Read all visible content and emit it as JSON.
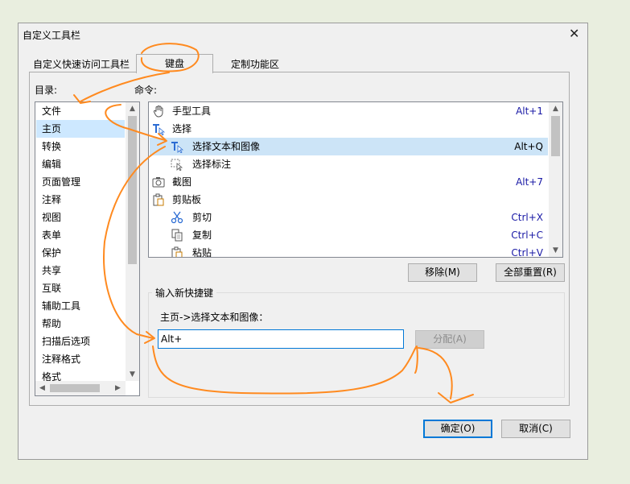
{
  "dialog": {
    "title": "自定义工具栏",
    "close_symbol": "✕"
  },
  "tabs": [
    {
      "label": "自定义快速访问工具栏",
      "active": false
    },
    {
      "label": "键盘",
      "active": true
    },
    {
      "label": "定制功能区",
      "active": false
    }
  ],
  "categories": {
    "label": "目录:",
    "items": [
      "文件",
      "主页",
      "转换",
      "编辑",
      "页面管理",
      "注释",
      "视图",
      "表单",
      "保护",
      "共享",
      "互联",
      "辅助工具",
      "帮助",
      "扫描后选项",
      "注释格式",
      "格式"
    ],
    "selected": "主页"
  },
  "commands": {
    "label": "命令:",
    "items": [
      {
        "label": "手型工具",
        "shortcut": "Alt+1",
        "icon": "hand-icon",
        "indent": false
      },
      {
        "label": "选择",
        "shortcut": "",
        "icon": "select-text-icon",
        "indent": false
      },
      {
        "label": "选择文本和图像",
        "shortcut": "Alt+Q",
        "icon": "select-text-image-icon",
        "indent": true,
        "selected": true
      },
      {
        "label": "选择标注",
        "shortcut": "",
        "icon": "select-annotation-icon",
        "indent": true
      },
      {
        "label": "截图",
        "shortcut": "Alt+7",
        "icon": "camera-icon",
        "indent": false
      },
      {
        "label": "剪贴板",
        "shortcut": "",
        "icon": "clipboard-icon",
        "indent": false
      },
      {
        "label": "剪切",
        "shortcut": "Ctrl+X",
        "icon": "scissors-icon",
        "indent": true
      },
      {
        "label": "复制",
        "shortcut": "Ctrl+C",
        "icon": "copy-icon",
        "indent": true
      },
      {
        "label": "粘贴",
        "shortcut": "Ctrl+V",
        "icon": "paste-icon",
        "indent": true
      }
    ]
  },
  "buttons": {
    "remove": "移除(M)",
    "reset_all": "全部重置(R)",
    "assign": "分配(A)",
    "ok": "确定(O)",
    "cancel": "取消(C)"
  },
  "new_shortcut": {
    "group_label": "输入新快捷键",
    "path_label": "主页->选择文本和图像：",
    "input_value": "Alt+"
  },
  "colors": {
    "selection": "#cce4f7",
    "focus_border": "#0078d7",
    "shortcut_text": "#1a1aa6",
    "annotation": "#ff8a1f"
  }
}
